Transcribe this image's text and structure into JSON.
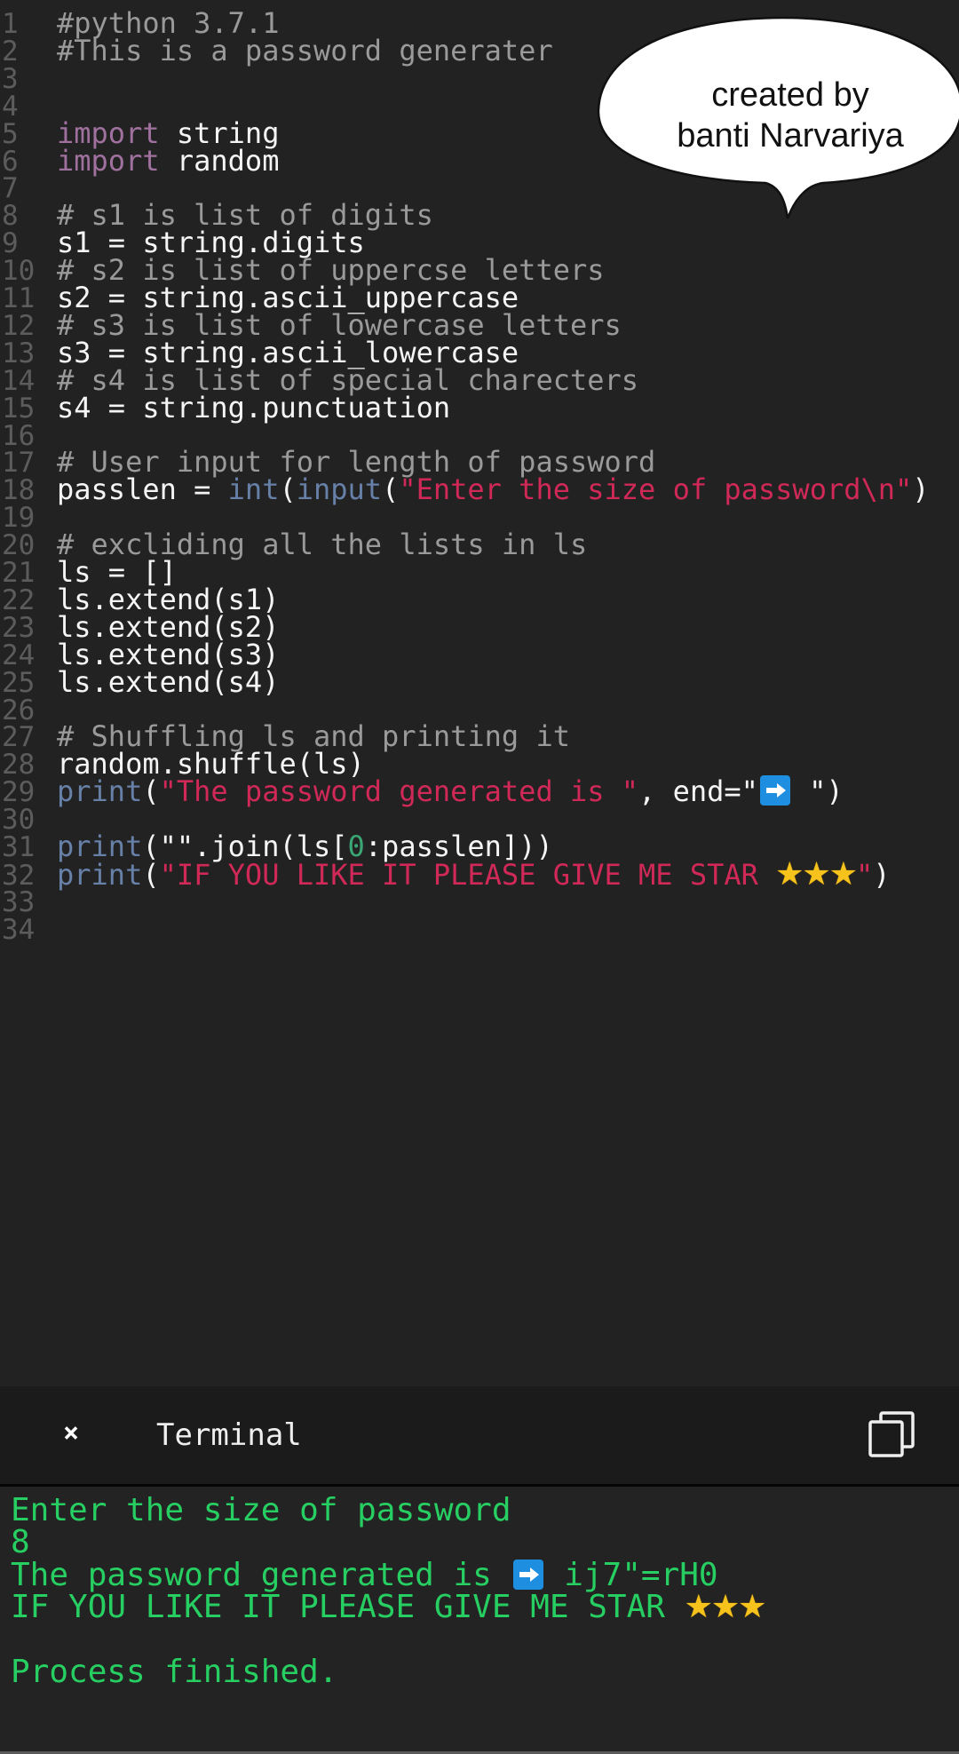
{
  "editor": {
    "language": "python",
    "lines": [
      {
        "n": "1",
        "tokens": [
          {
            "t": "comment",
            "v": "#python 3.7.1"
          }
        ]
      },
      {
        "n": "2",
        "tokens": [
          {
            "t": "comment",
            "v": "#This is a password generater"
          }
        ]
      },
      {
        "n": "3",
        "tokens": []
      },
      {
        "n": "4",
        "tokens": []
      },
      {
        "n": "5",
        "tokens": [
          {
            "t": "keyword",
            "v": "import"
          },
          {
            "t": "plain",
            "v": " string"
          }
        ]
      },
      {
        "n": "6",
        "tokens": [
          {
            "t": "keyword",
            "v": "import"
          },
          {
            "t": "plain",
            "v": " random"
          }
        ]
      },
      {
        "n": "7",
        "tokens": []
      },
      {
        "n": "8",
        "tokens": [
          {
            "t": "comment",
            "v": "# s1 is list of digits"
          }
        ]
      },
      {
        "n": "9",
        "tokens": [
          {
            "t": "plain",
            "v": "s1 = string.digits"
          }
        ]
      },
      {
        "n": "10",
        "tokens": [
          {
            "t": "comment",
            "v": "# s2 is list of uppercse letters"
          }
        ]
      },
      {
        "n": "11",
        "tokens": [
          {
            "t": "plain",
            "v": "s2 = string.ascii_uppercase"
          }
        ]
      },
      {
        "n": "12",
        "tokens": [
          {
            "t": "comment",
            "v": "# s3 is list of lowercase letters"
          }
        ]
      },
      {
        "n": "13",
        "tokens": [
          {
            "t": "plain",
            "v": "s3 = string.ascii_lowercase"
          }
        ]
      },
      {
        "n": "14",
        "tokens": [
          {
            "t": "comment",
            "v": "# s4 is list of special charecters"
          }
        ]
      },
      {
        "n": "15",
        "tokens": [
          {
            "t": "plain",
            "v": "s4 = string.punctuation"
          }
        ]
      },
      {
        "n": "16",
        "tokens": []
      },
      {
        "n": "17",
        "tokens": [
          {
            "t": "comment",
            "v": "# User input for length of password"
          }
        ]
      },
      {
        "n": "18",
        "tokens": [
          {
            "t": "plain",
            "v": "passlen = "
          },
          {
            "t": "builtin",
            "v": "int"
          },
          {
            "t": "plain",
            "v": "("
          },
          {
            "t": "builtin",
            "v": "input"
          },
          {
            "t": "plain",
            "v": "("
          },
          {
            "t": "string",
            "v": "\"Enter the size of password\\n\""
          },
          {
            "t": "plain",
            "v": ")"
          }
        ]
      },
      {
        "n": "19",
        "tokens": []
      },
      {
        "n": "20",
        "tokens": [
          {
            "t": "comment",
            "v": "# excliding all the lists in ls"
          }
        ]
      },
      {
        "n": "21",
        "tokens": [
          {
            "t": "plain",
            "v": "ls = []"
          }
        ]
      },
      {
        "n": "22",
        "tokens": [
          {
            "t": "plain",
            "v": "ls.extend(s1)"
          }
        ]
      },
      {
        "n": "23",
        "tokens": [
          {
            "t": "plain",
            "v": "ls.extend(s2)"
          }
        ]
      },
      {
        "n": "24",
        "tokens": [
          {
            "t": "plain",
            "v": "ls.extend(s3)"
          }
        ]
      },
      {
        "n": "25",
        "tokens": [
          {
            "t": "plain",
            "v": "ls.extend(s4)"
          }
        ]
      },
      {
        "n": "26",
        "tokens": []
      },
      {
        "n": "27",
        "tokens": [
          {
            "t": "comment",
            "v": "# Shuffling ls and printing it"
          }
        ]
      },
      {
        "n": "28",
        "tokens": [
          {
            "t": "plain",
            "v": "random.shuffle(ls)"
          }
        ]
      },
      {
        "n": "29",
        "tokens": [
          {
            "t": "builtin",
            "v": "print"
          },
          {
            "t": "plain",
            "v": "("
          },
          {
            "t": "string",
            "v": "\"The password generated is \""
          },
          {
            "t": "plain",
            "v": ", end=\""
          },
          {
            "t": "arrow",
            "v": "arrow-right-emoji"
          },
          {
            "t": "plain",
            "v": " \")"
          }
        ]
      },
      {
        "n": "30",
        "tokens": []
      },
      {
        "n": "31",
        "tokens": [
          {
            "t": "builtin",
            "v": "print"
          },
          {
            "t": "plain",
            "v": "(\"\".join(ls["
          },
          {
            "t": "number",
            "v": "0"
          },
          {
            "t": "plain",
            "v": ":passlen]))"
          }
        ]
      },
      {
        "n": "32",
        "tokens": [
          {
            "t": "builtin",
            "v": "print"
          },
          {
            "t": "plain",
            "v": "("
          },
          {
            "t": "string",
            "v": "\"IF YOU LIKE IT PLEASE GIVE ME STAR "
          },
          {
            "t": "stars",
            "v": "★★★"
          },
          {
            "t": "string",
            "v": "\""
          },
          {
            "t": "plain",
            "v": ")"
          }
        ]
      },
      {
        "n": "33",
        "tokens": []
      },
      {
        "n": "34",
        "tokens": []
      }
    ]
  },
  "bubble": {
    "line1": "created by",
    "line2": "banti Narvariya"
  },
  "terminal": {
    "close_label": "×",
    "title": "Terminal",
    "copy_icon": "copy-icon",
    "output": [
      {
        "parts": [
          {
            "t": "text",
            "v": "Enter the size of password"
          }
        ]
      },
      {
        "parts": [
          {
            "t": "text",
            "v": "8"
          }
        ]
      },
      {
        "parts": [
          {
            "t": "text",
            "v": "The password generated is "
          },
          {
            "t": "arrow",
            "v": "arrow-right-emoji"
          },
          {
            "t": "text",
            "v": " ij7\"=rH0"
          }
        ]
      },
      {
        "parts": [
          {
            "t": "text",
            "v": "IF YOU LIKE IT PLEASE GIVE ME STAR "
          },
          {
            "t": "stars",
            "v": "★★★"
          }
        ]
      },
      {
        "parts": []
      },
      {
        "parts": [
          {
            "t": "text",
            "v": "Process finished."
          }
        ]
      }
    ]
  },
  "colors": {
    "editor_bg": "#222222",
    "comment": "#9a9a9a",
    "keyword": "#a0719e",
    "builtin": "#6780a8",
    "string": "#d02958",
    "number": "#3aa673",
    "terminal_text": "#27cf62"
  }
}
